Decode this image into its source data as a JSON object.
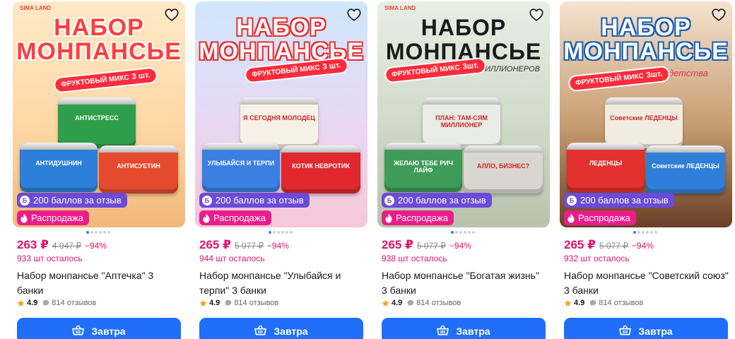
{
  "products": [
    {
      "image": {
        "brand": "SIMA LAND",
        "headline": "НАБОР МОНПАНСЬЕ",
        "subheadline": "",
        "mix_label": "ФРУКТОВЫЙ МИКС",
        "count_label": "3 шт.",
        "cans": [
          "АНТИСТРЕСС",
          "АНТИДУШНИН",
          "АНТИСУЕТИН"
        ]
      },
      "rewards_badge": "200 баллов за отзыв",
      "rewards_coin": "Б",
      "sale_badge": "Распродажа",
      "price": "263 ₽",
      "old_price": "4 947 ₽",
      "discount": "−94%",
      "stock": "933 шт осталось",
      "title": "Набор монпансье \"Аптечка\" 3 банки",
      "rating": "4.9",
      "reviews": "814 отзывов",
      "button_label": "Завтра",
      "colors": {
        "can1": "#2f9e4a",
        "can2": "#2e7fd8",
        "can3": "#e64a2e"
      }
    },
    {
      "image": {
        "brand": "",
        "headline": "НАБОР МОНПАНСЬЕ",
        "subheadline": "",
        "mix_label": "ФРУКТОВЫЙ МИКС",
        "count_label": "3 шт.",
        "cans": [
          "Я СЕГОДНЯ МОЛОДЕЦ",
          "УЛЫБАЙСЯ И ТЕРПИ",
          "КОТИК НЕВРОТИК"
        ]
      },
      "rewards_badge": "200 баллов за отзыв",
      "rewards_coin": "Б",
      "sale_badge": "Распродажа",
      "price": "265 ₽",
      "old_price": "5 077 ₽",
      "discount": "−94%",
      "stock": "944 шт осталось",
      "title": "Набор монпансье \"Улыбайся и терпи\" 3 банки",
      "rating": "4.9",
      "reviews": "814 отзывов",
      "button_label": "Завтра",
      "colors": {
        "can1": "#f5f1e6",
        "can2": "#3b7fe0",
        "can3": "#e0282e"
      }
    },
    {
      "image": {
        "brand": "SIMA LAND",
        "headline": "НАБОР МОНПАНСЬЕ",
        "subheadline": "ДЛЯ МИЛЛИОНЕРОВ",
        "mix_label": "ФРУКТОВЫЙ МИКС",
        "count_label": "3шт.",
        "cans": [
          "ПЛАН: ТАМ-СЯМ МИЛЛИОНЕР",
          "ЖЕЛАЮ ТЕБЕ РИЧ ЛАЙФ",
          "АЛЛО, БИЗНЕС?"
        ]
      },
      "rewards_badge": "200 баллов за отзыв",
      "rewards_coin": "Б",
      "sale_badge": "Распродажа",
      "price": "265 ₽",
      "old_price": "5 077 ₽",
      "discount": "−94%",
      "stock": "938 шт осталось",
      "title": "Набор монпансье \"Богатая жизнь\" 3 банки",
      "rating": "4.9",
      "reviews": "814 отзывов",
      "button_label": "Завтра",
      "colors": {
        "can1": "#e8ece4",
        "can2": "#3f9b58",
        "can3": "#d9d6cf"
      }
    },
    {
      "image": {
        "brand": "",
        "headline": "НАБОР МОНПАНСЬЕ",
        "subheadline": "вкус детства",
        "mix_label": "ФРУКТОВЫЙ МИКС",
        "count_label": "3шт.",
        "cans": [
          "Советские ЛЕДЕНЦЫ",
          "ЛЕДЕНЦЫ",
          "Советские ЛЕДЕНЦЫ"
        ]
      },
      "rewards_badge": "200 баллов за отзыв",
      "rewards_coin": "Б",
      "sale_badge": "Распродажа",
      "price": "265 ₽",
      "old_price": "5 077 ₽",
      "discount": "−94%",
      "stock": "932 шт осталось",
      "title": "Набор монпансье \"Советский союз\" 3 банки",
      "rating": "4.9",
      "reviews": "814 отзывов",
      "button_label": "Завтра",
      "colors": {
        "can1": "#f2ece0",
        "can2": "#e2312e",
        "can3": "#2f7fd8"
      }
    }
  ],
  "icons": {
    "heart": "heart-outline-icon",
    "flame": "flame-icon",
    "star": "star-icon",
    "reviews": "speech-bubble-icon",
    "basket": "basket-icon"
  },
  "theme": {
    "price_color": "#e0126e",
    "rewards_color": "#6c4bd8",
    "sale_color": "#ea1d8b",
    "button_color": "#1f6ffa",
    "star_color": "#f5a623"
  }
}
